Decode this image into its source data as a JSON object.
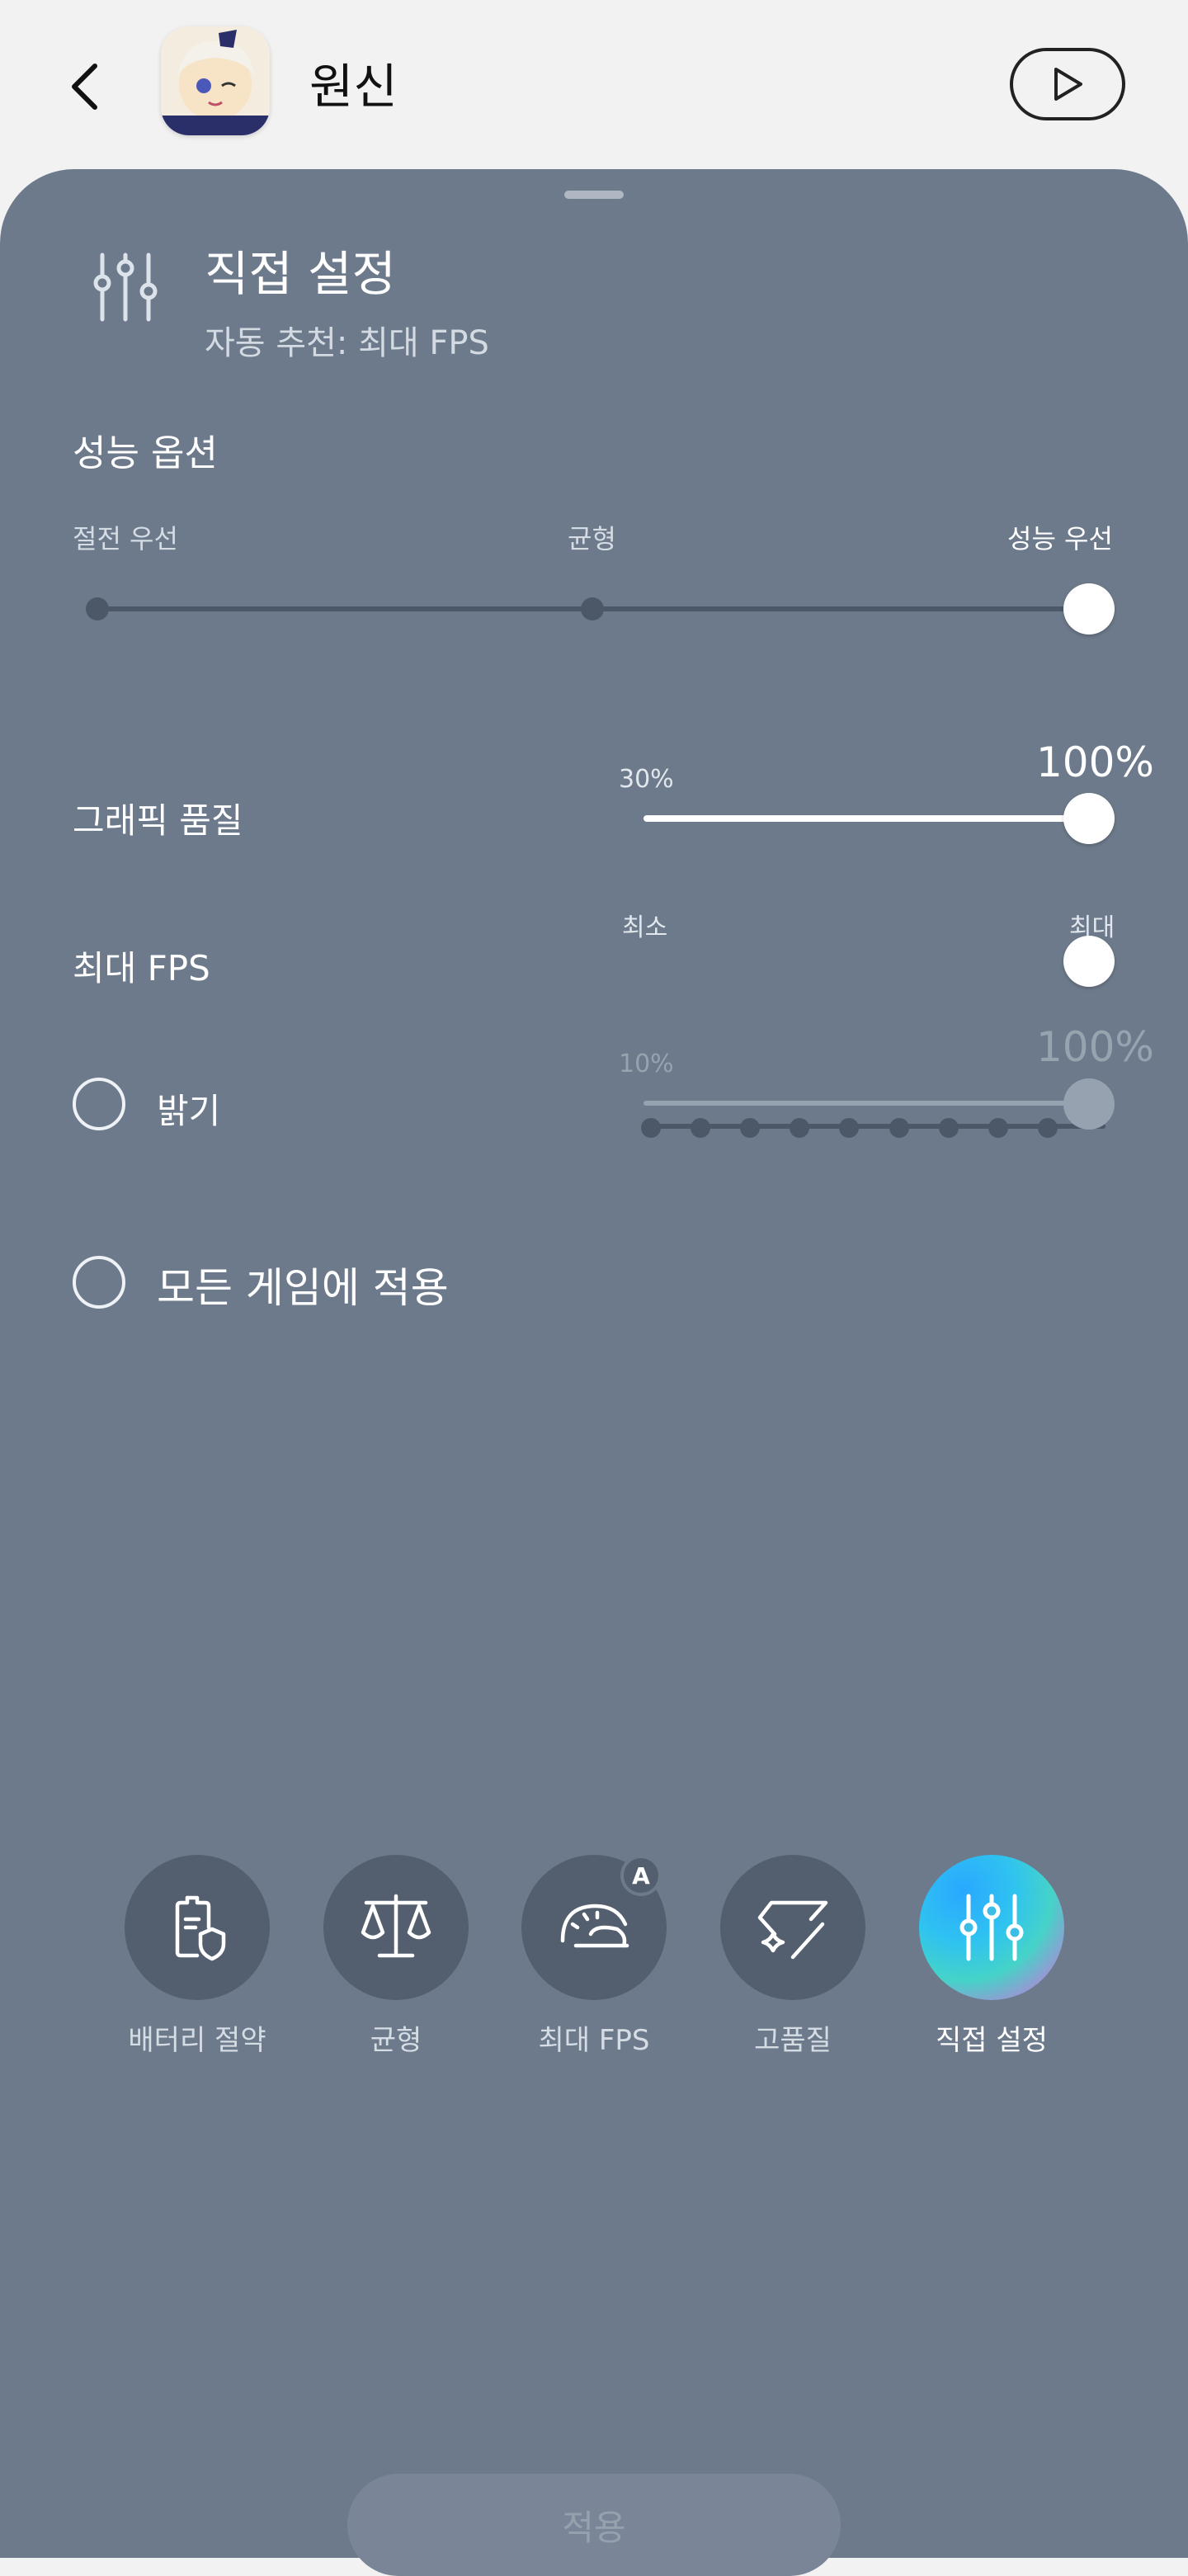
{
  "header": {
    "app_title": "원신",
    "back_icon": "chevron-left-icon",
    "play_icon": "play-icon"
  },
  "panel": {
    "mode_title": "직접 설정",
    "mode_subtitle": "자동 추천: 최대 FPS",
    "performance": {
      "title": "성능 옵션",
      "options": [
        "절전 우선",
        "균형",
        "성능 우선"
      ],
      "selected_index": 2
    },
    "graphics": {
      "label": "그래픽 품질",
      "min_label": "30%",
      "value_label": "100%",
      "value_fraction": 1.0
    },
    "fps": {
      "label": "최대 FPS",
      "min_label": "최소",
      "max_label": "최대",
      "steps": 10,
      "selected_step": 10
    },
    "brightness": {
      "label": "밝기",
      "min_label": "10%",
      "value_label": "100%",
      "value_fraction": 1.0,
      "enabled": false
    },
    "apply_all": {
      "label": "모든 게임에 적용",
      "checked": false
    },
    "modes": [
      {
        "label": "배터리 절약",
        "icon": "battery-shield-icon"
      },
      {
        "label": "균형",
        "icon": "balance-scale-icon"
      },
      {
        "label": "최대 FPS",
        "icon": "speedometer-icon",
        "badge": "A"
      },
      {
        "label": "고품질",
        "icon": "diamond-sparkle-icon"
      },
      {
        "label": "직접 설정",
        "icon": "sliders-icon",
        "active": true
      }
    ],
    "apply_button": "적용"
  },
  "colors": {
    "panel_bg": "#6d7a8b",
    "header_bg": "#f2f2f2",
    "mode_button_bg": "#535f6f",
    "accent_gradient_start": "#29a8ff",
    "accent_gradient_end": "#c07ad8"
  }
}
